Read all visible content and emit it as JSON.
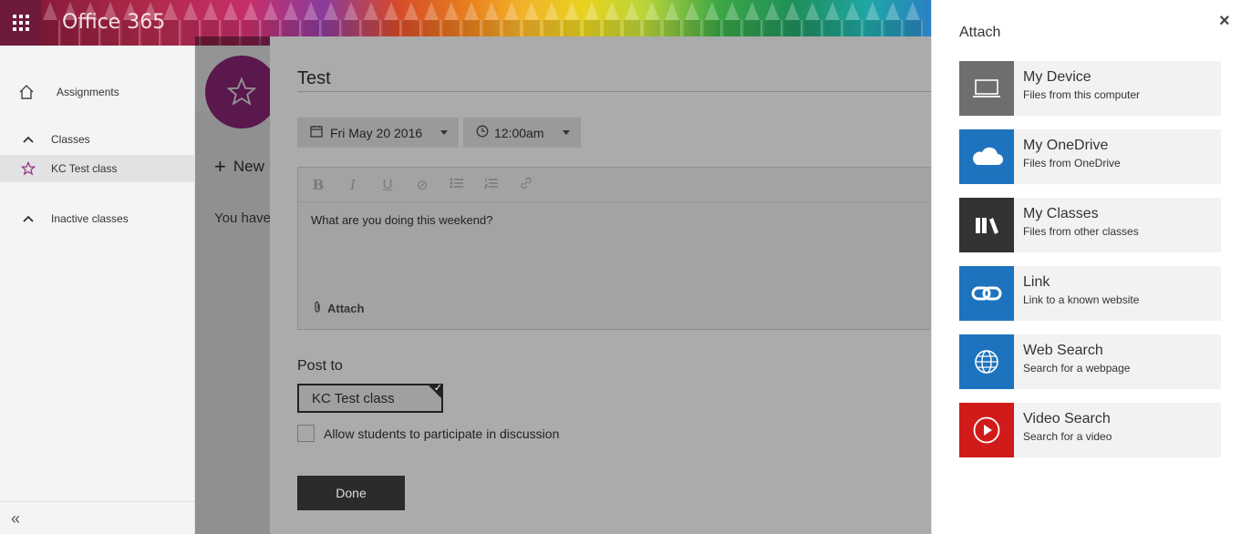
{
  "app": {
    "brand": "Office 365"
  },
  "leftnav": {
    "items": [
      {
        "label": "Assignments",
        "icon": "home-icon"
      },
      {
        "label": "Classes",
        "icon": "chevron-up-icon"
      },
      {
        "label": "KC Test class",
        "icon": "star-icon"
      },
      {
        "label": "Inactive classes",
        "icon": "chevron-up-icon"
      }
    ],
    "collapse_icon": "double-chevron-left-icon"
  },
  "main": {
    "new_label": "New",
    "empty_text": "You have"
  },
  "editor": {
    "title_value": "Test",
    "date_value": "Fri May 20 2016",
    "time_value": "12:00am",
    "body_text": "What are you doing this weekend?",
    "attach_label": "Attach",
    "toolbar": [
      "B",
      "I",
      "U",
      "⊘",
      "bullets",
      "numbering",
      "link"
    ],
    "post_to_label": "Post to",
    "post_to_value": "KC Test class",
    "discussion_label": "Allow students to participate in discussion",
    "done_label": "Done"
  },
  "panel": {
    "title": "Attach",
    "close": "×",
    "options": [
      {
        "title": "My Device",
        "subtitle": "Files from this computer",
        "color": "#6e6e6e",
        "icon": "laptop-icon"
      },
      {
        "title": "My OneDrive",
        "subtitle": "Files from OneDrive",
        "color": "#1e73be",
        "icon": "cloud-icon"
      },
      {
        "title": "My Classes",
        "subtitle": "Files from other classes",
        "color": "#333333",
        "icon": "books-icon"
      },
      {
        "title": "Link",
        "subtitle": "Link to a known website",
        "color": "#1e73be",
        "icon": "link-icon"
      },
      {
        "title": "Web Search",
        "subtitle": "Search for a webpage",
        "color": "#1e73be",
        "icon": "globe-icon"
      },
      {
        "title": "Video Search",
        "subtitle": "Search for a video",
        "color": "#d11a1a",
        "icon": "play-icon"
      }
    ]
  },
  "colors": {
    "class_accent": "#9b2a86",
    "waffle": "#6d1a3c"
  }
}
